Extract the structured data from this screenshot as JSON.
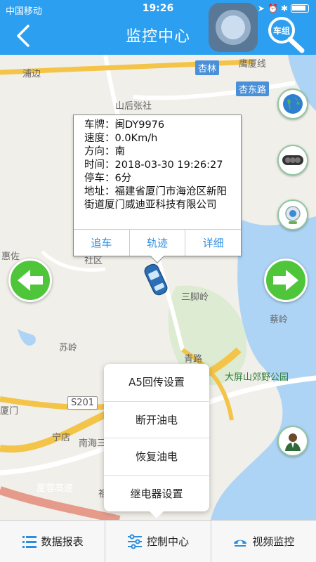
{
  "status_bar": {
    "carrier": "中国移动",
    "time": "19:26"
  },
  "header": {
    "title": "监控中心",
    "group_button_label": "车组"
  },
  "map": {
    "places": [
      "浦边",
      "杏林",
      "杏东路",
      "山后张社",
      "惠佐",
      "三脚岭",
      "苏岭",
      "蔡岭",
      "大屏山郊野公园",
      "宁店",
      "南海三",
      "厦蓉高速",
      "厦门",
      "祖宫",
      "鹰厦线",
      "社区"
    ],
    "road_codes": [
      "S201"
    ],
    "road_names": [
      "青路"
    ]
  },
  "vehicle_info": {
    "plate": "车牌：闽DY9976",
    "speed": "速度：0.0Km/h",
    "direction": "方向：南",
    "time": "时间：2018-03-30 19:26:27",
    "parking": "停车：6分",
    "address": "地址：福建省厦门市海沧区新阳街道厦门威迪亚科技有限公司",
    "actions": [
      "追车",
      "轨迹",
      "详细"
    ]
  },
  "control_menu": {
    "items": [
      "A5回传设置",
      "断开油电",
      "恢复油电",
      "继电器设置"
    ]
  },
  "tabs": [
    {
      "label": "数据报表",
      "icon": "list-icon"
    },
    {
      "label": "控制中心",
      "icon": "sliders-icon"
    },
    {
      "label": "视频监控",
      "icon": "camera-icon"
    }
  ],
  "colors": {
    "header": "#2c9ff0",
    "link": "#2c8ee0",
    "arrow": "#4fc63a",
    "water": "#aed4f5"
  }
}
